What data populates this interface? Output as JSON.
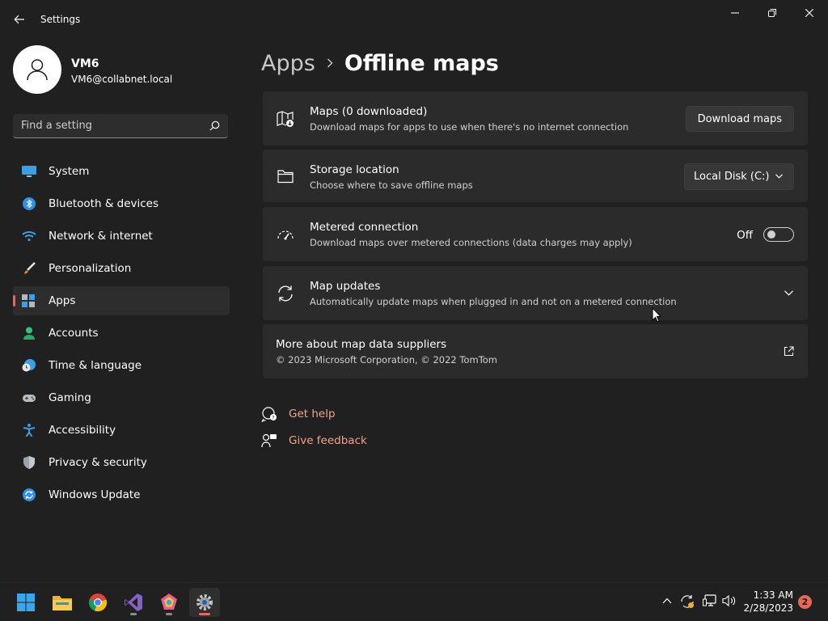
{
  "window": {
    "title": "Settings"
  },
  "profile": {
    "name": "VM6",
    "email": "VM6@collabnet.local"
  },
  "search": {
    "placeholder": "Find a setting"
  },
  "sidebar": {
    "items": [
      {
        "label": "System",
        "icon": "monitor-icon",
        "active": false
      },
      {
        "label": "Bluetooth & devices",
        "icon": "bluetooth-icon",
        "active": false
      },
      {
        "label": "Network & internet",
        "icon": "wifi-icon",
        "active": false
      },
      {
        "label": "Personalization",
        "icon": "brush-icon",
        "active": false
      },
      {
        "label": "Apps",
        "icon": "apps-icon",
        "active": true
      },
      {
        "label": "Accounts",
        "icon": "person-icon",
        "active": false
      },
      {
        "label": "Time & language",
        "icon": "clock-globe-icon",
        "active": false
      },
      {
        "label": "Gaming",
        "icon": "gamepad-icon",
        "active": false
      },
      {
        "label": "Accessibility",
        "icon": "accessibility-icon",
        "active": false
      },
      {
        "label": "Privacy & security",
        "icon": "shield-icon",
        "active": false
      },
      {
        "label": "Windows Update",
        "icon": "update-icon",
        "active": false
      }
    ]
  },
  "breadcrumb": {
    "parent": "Apps",
    "current": "Offline maps"
  },
  "cards": {
    "maps": {
      "title": "Maps (0 downloaded)",
      "subtitle": "Download maps for apps to use when there's no internet connection",
      "button": "Download maps"
    },
    "storage": {
      "title": "Storage location",
      "subtitle": "Choose where to save offline maps",
      "value": "Local Disk (C:)"
    },
    "metered": {
      "title": "Metered connection",
      "subtitle": "Download maps over metered connections (data charges may apply)",
      "state": "Off"
    },
    "updates": {
      "title": "Map updates",
      "subtitle": "Automatically update maps when plugged in and not on a metered connection"
    },
    "suppliers": {
      "title": "More about map data suppliers",
      "subtitle": "© 2023 Microsoft Corporation, © 2022 TomTom"
    }
  },
  "help": {
    "get_help": "Get help",
    "feedback": "Give feedback"
  },
  "taskbar": {
    "apps": [
      "start-icon",
      "file-explorer-icon",
      "chrome-icon",
      "visual-studio-icon",
      "app-icon",
      "settings-icon"
    ],
    "time": "1:33 AM",
    "date": "2/28/2023",
    "notifications": "2"
  },
  "colors": {
    "accent": "#e36a5a",
    "link": "#f0a28f",
    "background": "#202020",
    "card": "#2b2b2b"
  }
}
